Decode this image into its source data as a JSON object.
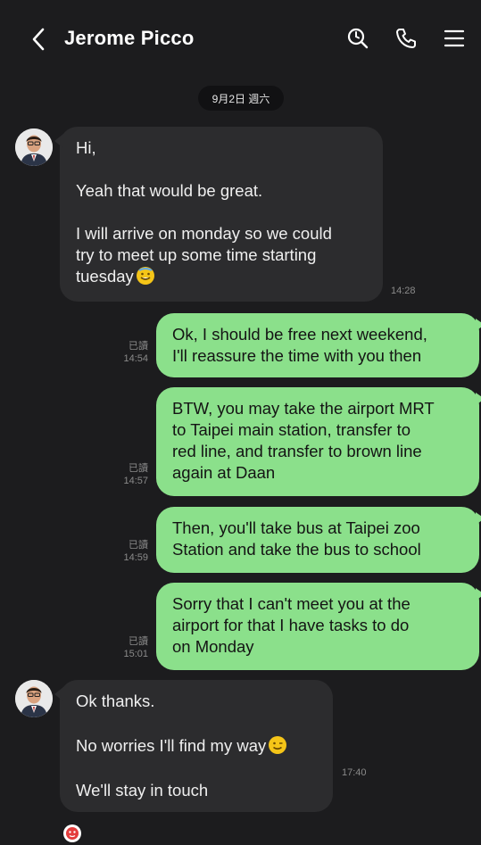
{
  "header": {
    "title": "Jerome Picco",
    "back_icon": "chevron-left-icon",
    "search_icon": "search-icon",
    "call_icon": "phone-icon",
    "menu_icon": "menu-icon"
  },
  "date_separator": "9月2日 週六",
  "messages": [
    {
      "direction": "incoming",
      "lines": [
        "Hi,",
        "Yeah that would be great.",
        "I will arrive on monday so we could\ntry to meet up some time starting\ntuesday"
      ],
      "time": "14:28"
    },
    {
      "direction": "outgoing",
      "text": "Ok, I should be free next weekend,\nI'll reassure the time with you then",
      "read": "已讀",
      "time": "14:54"
    },
    {
      "direction": "outgoing",
      "text": "BTW, you may take the airport MRT\nto Taipei main station, transfer to\nred line, and transfer to brown line\nagain at Daan",
      "read": "已讀",
      "time": "14:57"
    },
    {
      "direction": "outgoing",
      "text": "Then, you'll take bus at Taipei zoo\nStation and take the bus to school",
      "read": "已讀",
      "time": "14:59"
    },
    {
      "direction": "outgoing",
      "text": "Sorry that I can't meet you at the\nairport for that I have tasks to do\non Monday",
      "read": "已讀",
      "time": "15:01"
    },
    {
      "direction": "incoming",
      "lines": [
        "Ok thanks.",
        "No worries I'll find my way",
        "We'll stay in touch"
      ],
      "time": "17:40"
    }
  ],
  "colors": {
    "background": "#1c1c1e",
    "incoming_bubble": "#2c2c2e",
    "outgoing_bubble": "#8be08b"
  }
}
